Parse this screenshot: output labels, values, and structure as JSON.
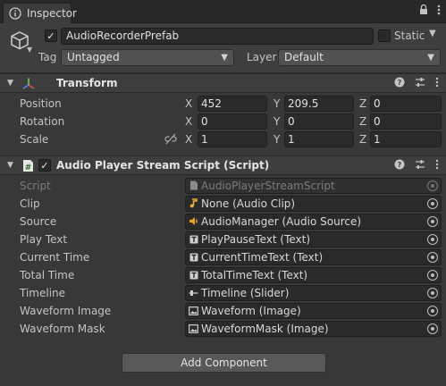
{
  "tab": {
    "label": "Inspector"
  },
  "header": {
    "name": "AudioRecorderPrefab",
    "active_checkmark": "✓",
    "static_label": "Static",
    "tag_label": "Tag",
    "tag_value": "Untagged",
    "layer_label": "Layer",
    "layer_value": "Default"
  },
  "transform": {
    "title": "Transform",
    "rows": [
      {
        "label": "Position",
        "x": "452",
        "y": "209.5",
        "z": "0"
      },
      {
        "label": "Rotation",
        "x": "0",
        "y": "0",
        "z": "0"
      },
      {
        "label": "Scale",
        "x": "1",
        "y": "1",
        "z": "1"
      }
    ],
    "axis": {
      "x": "X",
      "y": "Y",
      "z": "Z"
    }
  },
  "script_component": {
    "title": "Audio Player Stream Script (Script)",
    "enabled_checkmark": "✓",
    "fields": [
      {
        "label": "Script",
        "value": "AudioPlayerStreamScript",
        "icon": "script-asset-icon"
      },
      {
        "label": "Clip",
        "value": "None (Audio Clip)",
        "icon": "audio-clip-icon"
      },
      {
        "label": "Source",
        "value": "AudioManager (Audio Source)",
        "icon": "audio-source-icon"
      },
      {
        "label": "Play Text",
        "value": "PlayPauseText (Text)",
        "icon": "text-icon"
      },
      {
        "label": "Current Time",
        "value": "CurrentTimeText (Text)",
        "icon": "text-icon"
      },
      {
        "label": "Total Time",
        "value": "TotalTimeText (Text)",
        "icon": "text-icon"
      },
      {
        "label": "Timeline",
        "value": "Timeline (Slider)",
        "icon": "slider-icon"
      },
      {
        "label": "Waveform Image",
        "value": "Waveform (Image)",
        "icon": "image-icon"
      },
      {
        "label": "Waveform Mask",
        "value": "WaveformMask (Image)",
        "icon": "image-icon"
      }
    ]
  },
  "add_component": {
    "label": "Add Component"
  },
  "colors": {
    "panel_bg": "#383838",
    "header_bg": "#3e3e3e",
    "field_bg": "#2a2a2a",
    "button_bg": "#585858",
    "audio_clip_icon": "#e8b33a",
    "audio_source_icon": "#e8a028"
  }
}
